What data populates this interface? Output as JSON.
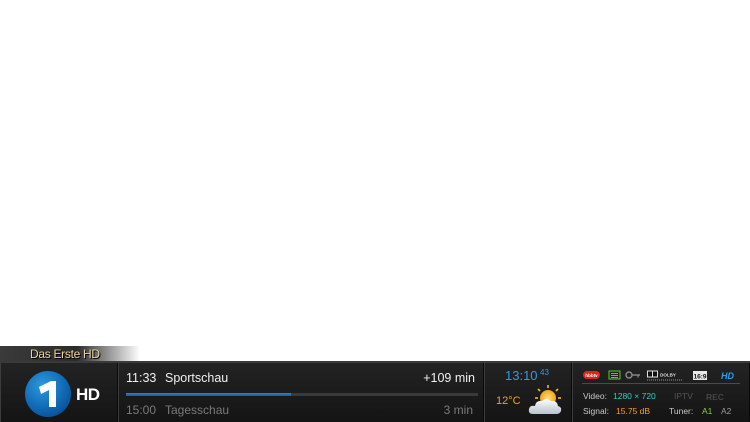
{
  "channel": {
    "name": "Das Erste HD",
    "logo_hd": "HD"
  },
  "epg": {
    "now": {
      "time": "11:33",
      "title": "Sportschau",
      "remaining": "+109 min",
      "progress_fraction": 0.47
    },
    "next": {
      "time": "15:00",
      "title": "Tagesschau",
      "remaining": "3 min"
    }
  },
  "clock": {
    "time": "13:10",
    "seconds": "43"
  },
  "weather": {
    "temperature": "12°C",
    "icon": "partly-cloudy-icon"
  },
  "tech": {
    "icons": {
      "hbbtv": "hbbtv",
      "subtitle_icon": "teletext-icon",
      "crypt_icon": "key-icon",
      "dolby": "DOLBY",
      "aspect": "16:9",
      "hd": "HD"
    },
    "video_label": "Video:",
    "video_value": "1280 × 720",
    "iptv_label": "IPTV",
    "rec_label": "REC",
    "signal_label": "Signal:",
    "signal_value": "15.75 dB",
    "tuner_label": "Tuner:",
    "tuner_a1": "A1",
    "tuner_a2": "A2"
  },
  "colors": {
    "accent_blue": "#2e9ae8",
    "temp_orange": "#f0a020",
    "video_cyan": "#2ed0c0",
    "tuner_active": "#8ad030"
  }
}
